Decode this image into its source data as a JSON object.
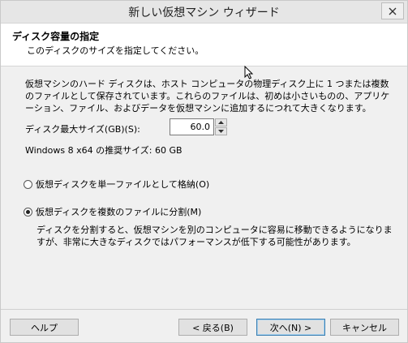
{
  "window": {
    "title": "新しい仮想マシン ウィザード",
    "close_icon": "close-icon"
  },
  "header": {
    "title": "ディスク容量の指定",
    "subtitle": "このディスクのサイズを指定してください。"
  },
  "content": {
    "description": "仮想マシンのハード ディスクは、ホスト コンピュータの物理ディスク上に 1 つまたは複数のファイルとして保存されています。これらのファイルは、初めは小さいものの、アプリケーション、ファイル、およびデータを仮想マシンに追加するにつれて大きくなります。",
    "max_size_label": "ディスク最大サイズ(GB)(S):",
    "max_size_value": "60.0",
    "recommended": "Windows 8 x64 の推奨サイズ: 60 GB"
  },
  "options": {
    "single_file_label": "仮想ディスクを単一ファイルとして格納(O)",
    "single_file_selected": false,
    "multiple_files_label": "仮想ディスクを複数のファイルに分割(M)",
    "multiple_files_selected": true,
    "multiple_files_description": "ディスクを分割すると、仮想マシンを別のコンピュータに容易に移動できるようになりますが、非常に大きなディスクではパフォーマンスが低下する可能性があります。"
  },
  "footer": {
    "help_label": "ヘルプ",
    "back_label": "< 戻る(B)",
    "next_label": "次へ(N) >",
    "cancel_label": "キャンセル"
  }
}
